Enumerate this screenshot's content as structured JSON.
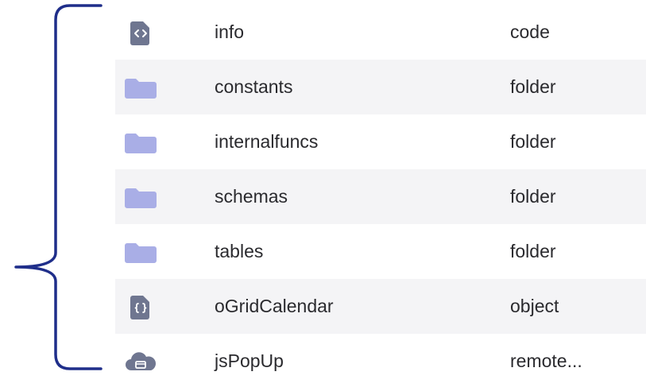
{
  "colors": {
    "brace": "#1f2e8a",
    "folder_icon": "#a9aee6",
    "file_icon": "#6f7690",
    "row_alt": "#f4f4f6"
  },
  "files": [
    {
      "name": "info",
      "kind": "code",
      "icon": "code-file-icon"
    },
    {
      "name": "constants",
      "kind": "folder",
      "icon": "folder-icon"
    },
    {
      "name": "internalfuncs",
      "kind": "folder",
      "icon": "folder-icon"
    },
    {
      "name": "schemas",
      "kind": "folder",
      "icon": "folder-icon"
    },
    {
      "name": "tables",
      "kind": "folder",
      "icon": "folder-icon"
    },
    {
      "name": "oGridCalendar",
      "kind": "object",
      "icon": "object-file-icon"
    },
    {
      "name": "jsPopUp",
      "kind": "remote...",
      "icon": "cloud-icon"
    }
  ]
}
